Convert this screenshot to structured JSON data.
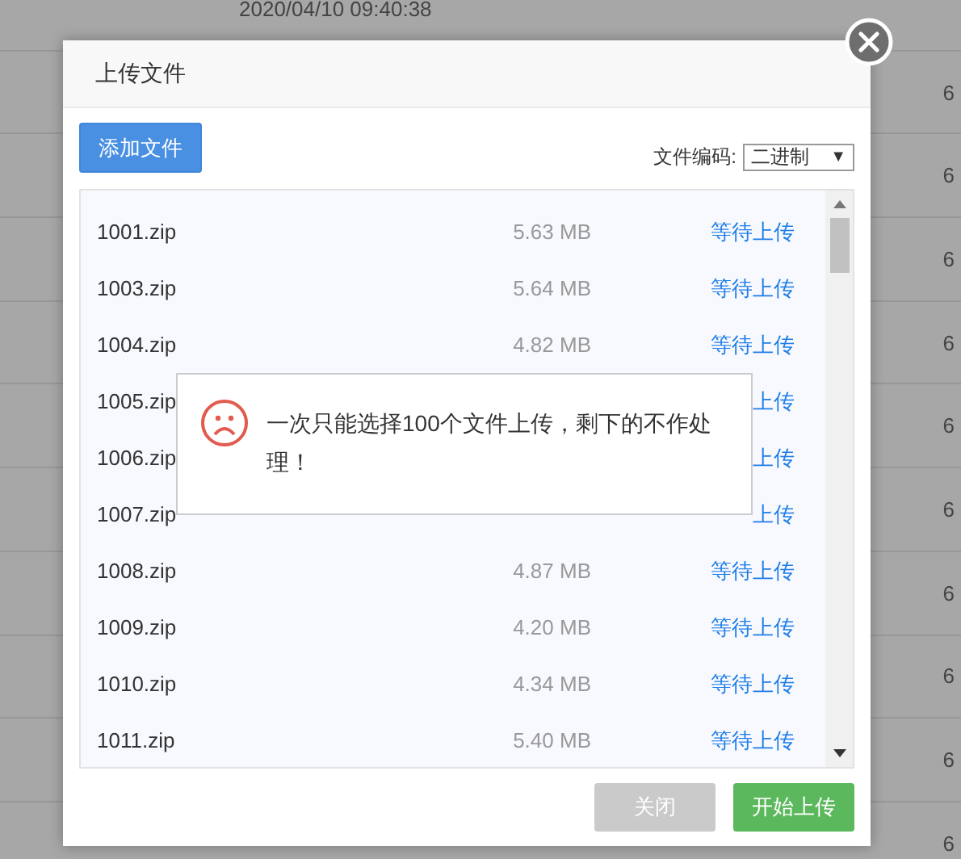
{
  "background_table": {
    "rows": [
      {
        "time": "2020/04/10 09:40:38",
        "column_2": ""
      },
      {
        "column_2": "6"
      },
      {
        "column_2": "6"
      },
      {
        "column_2": "6"
      },
      {
        "column_2": "6"
      },
      {
        "column_2": "6"
      },
      {
        "column_2": "6"
      },
      {
        "column_2": "6"
      },
      {
        "column_2": "6"
      },
      {
        "column_2": "6"
      },
      {
        "column_2": "6"
      }
    ]
  },
  "dialog": {
    "title": "上传文件",
    "add_button": "添加文件",
    "encoding": {
      "label": "文件编码:",
      "value": "二进制",
      "caret": "▼"
    },
    "files": [
      {
        "name": "1001.zip",
        "size": "5.63 MB",
        "status": "等待上传"
      },
      {
        "name": "1003.zip",
        "size": "5.64 MB",
        "status": "等待上传"
      },
      {
        "name": "1004.zip",
        "size": "4.82 MB",
        "status": "等待上传"
      },
      {
        "name": "1005.zip",
        "status": "上传"
      },
      {
        "name": "1006.zip",
        "status": "上传"
      },
      {
        "name": "1007.zip",
        "status": "上传"
      },
      {
        "name": "1008.zip",
        "size": "4.87 MB",
        "status": "等待上传"
      },
      {
        "name": "1009.zip",
        "size": "4.20 MB",
        "status": "等待上传"
      },
      {
        "name": "1010.zip",
        "size": "4.34 MB",
        "status": "等待上传"
      },
      {
        "name": "1011.zip",
        "size": "5.40 MB",
        "status": "等待上传"
      }
    ],
    "buttons": [
      {
        "label": "关闭",
        "kind": "secondary"
      },
      {
        "label": "开始上传",
        "kind": "primary"
      }
    ]
  },
  "toast": {
    "message": "一次只能选择100个文件上传，剩下的不作处理！"
  }
}
